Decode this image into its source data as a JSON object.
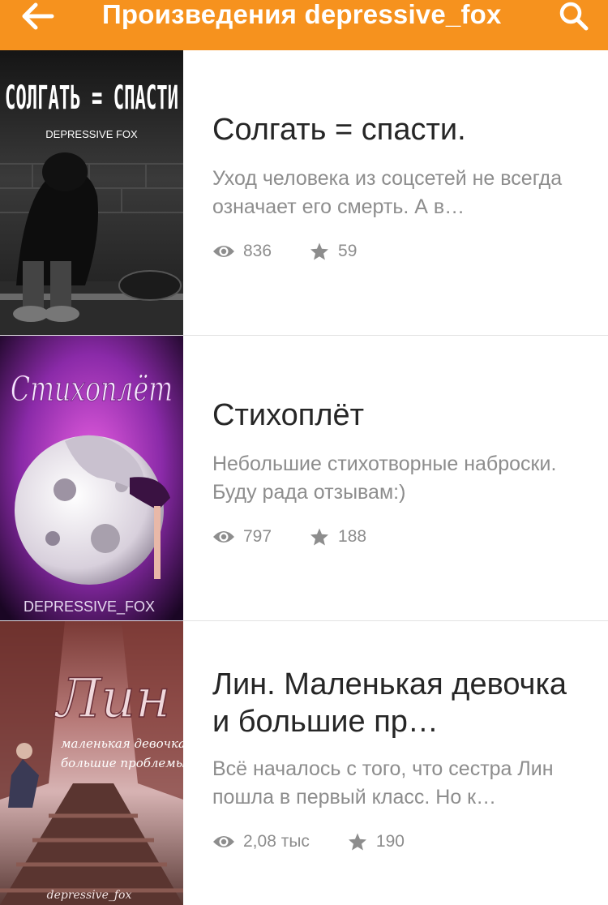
{
  "header": {
    "title": "Произведения depressive_fox",
    "back_icon": "arrow-left-icon",
    "search_icon": "search-icon",
    "background": "#f6921e"
  },
  "works": [
    {
      "title": "Солгать = спасти.",
      "description": "Уход человека из соцсетей не всегда означает его смерть. А в…",
      "views": "836",
      "stars": "59",
      "cover_text": "СОЛГАТЬ = СПАСТИ",
      "cover_author": "DEPRESSIVE FOX"
    },
    {
      "title": "Стихоплёт",
      "description": "Небольшие стихотворные наброски. Буду рада отзывам:)",
      "views": "797",
      "stars": "188",
      "cover_text": "Стихоплёт",
      "cover_author": "DEPRESSIVE_FOX"
    },
    {
      "title": "Лин. Маленькая девочка и большие пр…",
      "description": "Всё началось с того, что сестра Лин пошла в первый класс. Но к…",
      "views": "2,08 тыс",
      "stars": "190",
      "cover_text": "Лин",
      "cover_subtitle_1": "маленькая девочка",
      "cover_subtitle_2": "большие проблемы",
      "cover_author": "depressive_fox"
    }
  ],
  "icons": {
    "views": "eye-icon",
    "stars": "star-icon"
  },
  "colors": {
    "accent": "#f6921e",
    "meta": "#8d8d8d"
  }
}
